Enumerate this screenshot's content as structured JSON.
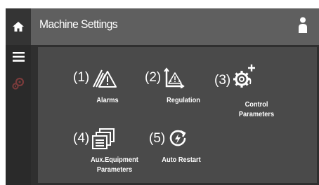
{
  "header": {
    "title": "Machine Settings"
  },
  "sidebar": {
    "icons": [
      "home-icon",
      "menu-icon",
      "settings-gears-icon"
    ]
  },
  "tiles": [
    {
      "number": "(1)",
      "label": "Alarms",
      "icon": "alarm-warning-icon"
    },
    {
      "number": "(2)",
      "label": "Regulation",
      "icon": "regulation-chart-warning-icon"
    },
    {
      "number": "(3)",
      "label": "Control\nParameters",
      "icon": "control-parameters-gear-plus-icon"
    },
    {
      "number": "(4)",
      "label": "Aux.Equipment\nParameters",
      "icon": "aux-equipment-stack-icon"
    },
    {
      "number": "(5)",
      "label": "Auto Restart",
      "icon": "auto-restart-icon"
    }
  ],
  "colors": {
    "frame": "#2f2f2f",
    "header": "#5f5f5f",
    "panel": "#4a4a4a",
    "text": "#ffffff"
  }
}
